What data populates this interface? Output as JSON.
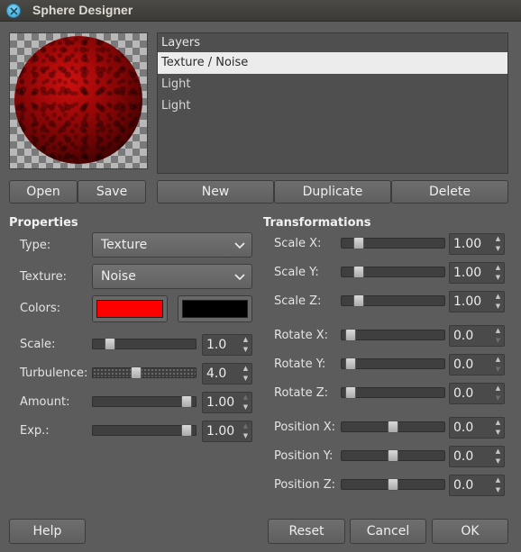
{
  "window": {
    "title": "Sphere Designer"
  },
  "layers": {
    "header": "Layers",
    "items": [
      "Texture / Noise",
      "Light",
      "Light"
    ],
    "selected_index": 0
  },
  "buttons": {
    "open": "Open",
    "save": "Save",
    "new": "New",
    "duplicate": "Duplicate",
    "delete": "Delete",
    "help": "Help",
    "reset": "Reset",
    "cancel": "Cancel",
    "ok": "OK"
  },
  "properties": {
    "title": "Properties",
    "type": {
      "label": "Type:",
      "value": "Texture"
    },
    "texture": {
      "label": "Texture:",
      "value": "Noise"
    },
    "colors": {
      "label": "Colors:",
      "color1": "#ff0000",
      "color2": "#000000"
    },
    "scale": {
      "label": "Scale:",
      "value": "1.0",
      "level": 0.1
    },
    "turbulence": {
      "label": "Turbulence:",
      "value": "4.0",
      "level": 0.4
    },
    "amount": {
      "label": "Amount:",
      "value": "1.00",
      "level": 1.0
    },
    "exp": {
      "label": "Exp.:",
      "value": "1.00",
      "level": 1.0
    }
  },
  "transformations": {
    "title": "Transformations",
    "scale_x": {
      "label": "Scale X:",
      "value": "1.00",
      "level": 0.1
    },
    "scale_y": {
      "label": "Scale Y:",
      "value": "1.00",
      "level": 0.1
    },
    "scale_z": {
      "label": "Scale Z:",
      "value": "1.00",
      "level": 0.1
    },
    "rotate_x": {
      "label": "Rotate X:",
      "value": "0.0",
      "level": 0.0
    },
    "rotate_y": {
      "label": "Rotate Y:",
      "value": "0.0",
      "level": 0.0
    },
    "rotate_z": {
      "label": "Rotate Z:",
      "value": "0.0",
      "level": 0.0
    },
    "position_x": {
      "label": "Position X:",
      "value": "0.0",
      "level": 0.5
    },
    "position_y": {
      "label": "Position Y:",
      "value": "0.0",
      "level": 0.5
    },
    "position_z": {
      "label": "Position Z:",
      "value": "0.0",
      "level": 0.5
    }
  },
  "icons": {
    "close": "close-icon",
    "dropdown": "chevron-down-icon",
    "spin_up": "arrow-up-icon",
    "spin_down": "arrow-down-icon"
  }
}
